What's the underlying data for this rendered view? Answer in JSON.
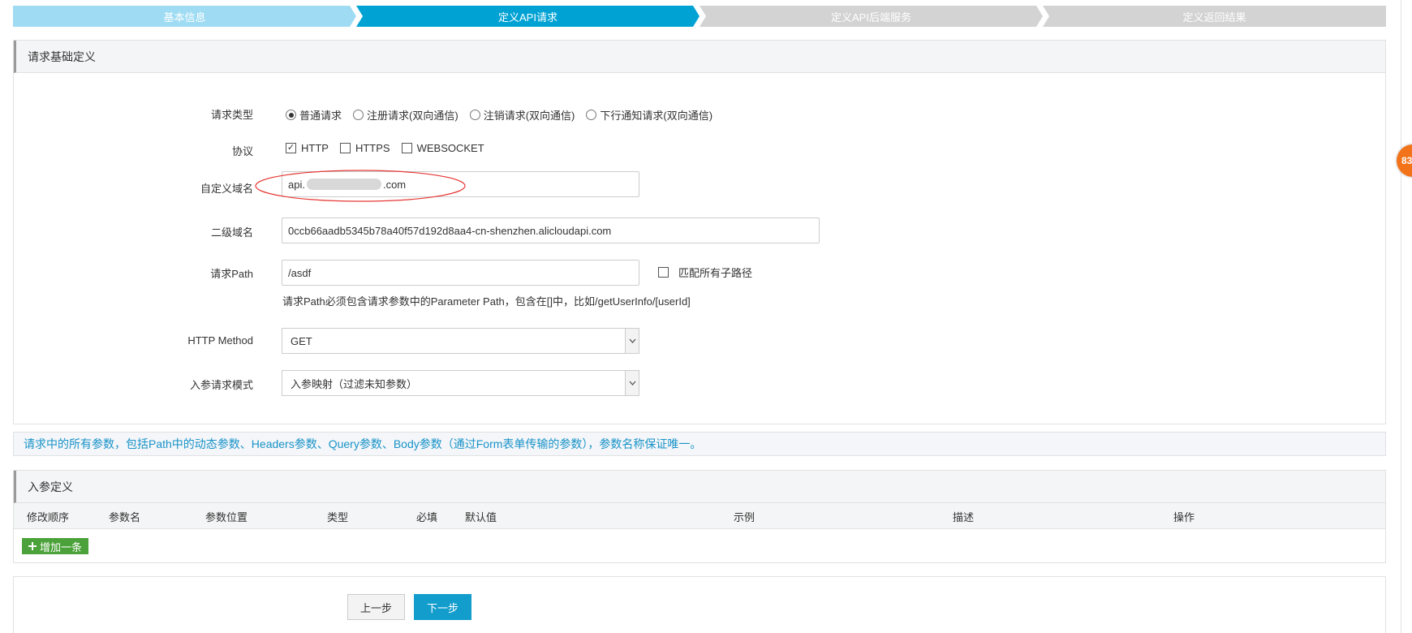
{
  "steps": [
    {
      "label": "基本信息",
      "state": "done"
    },
    {
      "label": "定义API请求",
      "state": "active"
    },
    {
      "label": "定义API后端服务",
      "state": "todo"
    },
    {
      "label": "定义返回结果",
      "state": "todo"
    }
  ],
  "colors": {
    "step_done": "#9fdcf3",
    "step_active": "#00a2d4",
    "step_todo": "#d3d3d3",
    "notice_text": "#1993c8",
    "add_button": "#4ca23a",
    "next_button": "#139dcc",
    "annotation": "#e53935",
    "badge": "#f27319"
  },
  "request_section": {
    "title": "请求基础定义",
    "request_type": {
      "label": "请求类型",
      "options": [
        "普通请求",
        "注册请求(双向通信)",
        "注销请求(双向通信)",
        "下行通知请求(双向通信)"
      ],
      "selected": "普通请求"
    },
    "protocol": {
      "label": "协议",
      "options": [
        {
          "name": "HTTP",
          "checked": true
        },
        {
          "name": "HTTPS",
          "checked": false
        },
        {
          "name": "WEBSOCKET",
          "checked": false
        }
      ]
    },
    "custom_domain": {
      "label": "自定义域名",
      "value_prefix": "api.",
      "value_suffix": ".com"
    },
    "sub_domain": {
      "label": "二级域名",
      "value": "0ccb66aadb5345b78a40f57d192d8aa4-cn-shenzhen.alicloudapi.com"
    },
    "path": {
      "label": "请求Path",
      "value": "/asdf",
      "match_all_label": "匹配所有子路径",
      "match_all_checked": false,
      "hint": "请求Path必须包含请求参数中的Parameter Path，包含在[]中，比如/getUserInfo/[userId]"
    },
    "method": {
      "label": "HTTP Method",
      "value": "GET"
    },
    "param_mode": {
      "label": "入参请求模式",
      "value": "入参映射（过滤未知参数）"
    }
  },
  "notice": "请求中的所有参数，包括Path中的动态参数、Headers参数、Query参数、Body参数（通过Form表单传输的参数），参数名称保证唯一。",
  "params_section": {
    "title": "入参定义",
    "columns": [
      "修改顺序",
      "参数名",
      "参数位置",
      "类型",
      "必填",
      "默认值",
      "示例",
      "描述",
      "操作"
    ],
    "add_label": "增加一条"
  },
  "footer": {
    "prev_label": "上一步",
    "next_label": "下一步"
  },
  "badge": {
    "text": "83"
  }
}
